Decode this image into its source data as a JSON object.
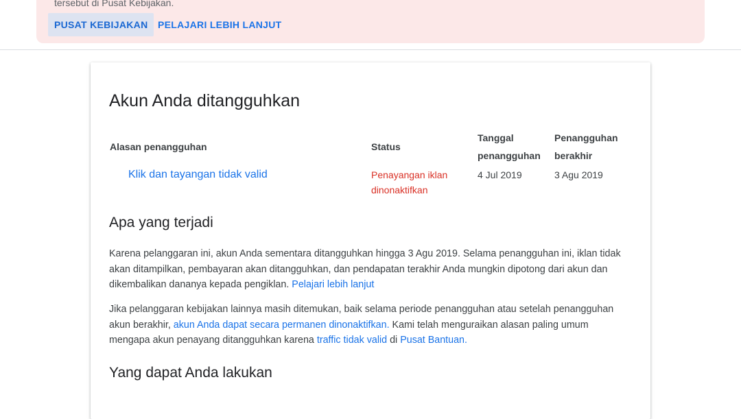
{
  "banner": {
    "cut_text": "tersebut di Pusat Kebijakan.",
    "policy_center_button": "PUSAT KEBIJAKAN",
    "learn_more_button": "PELAJARI LEBIH LANJUT"
  },
  "card": {
    "title": "Akun Anda ditangguhkan",
    "table": {
      "headers": {
        "reason": "Alasan penangguhan",
        "status": "Status",
        "suspend_date_1": "Tanggal",
        "suspend_date_2": "penangguhan",
        "suspend_end_1": "Penangguhan",
        "suspend_end_2": "berakhir"
      },
      "row": {
        "reason": "Klik dan tayangan tidak valid",
        "status_1": "Penayangan iklan",
        "status_2": "dinonaktifkan",
        "suspend_date": "4 Jul 2019",
        "suspend_end": "3 Agu 2019"
      }
    },
    "what_happened": {
      "heading": "Apa yang terjadi",
      "p1_line1": "Karena pelanggaran ini, akun Anda sementara ditangguhkan hingga 3 Agu 2019. Selama penangguhan ini, iklan tidak",
      "p1_line2": "akan ditampilkan, pembayaran akan ditangguhkan, dan pendapatan terakhir Anda mungkin dipotong dari akun dan",
      "p1_line3": "dikembalikan dananya kepada pengiklan. ",
      "p1_link": "Pelajari lebih lanjut",
      "p2_line1": "Jika pelanggaran kebijakan lainnya masih ditemukan, baik selama periode penangguhan atau setelah penangguhan",
      "p2_line2a": "akun berakhir, ",
      "p2_link1": "akun Anda dapat secara permanen dinonaktifkan.",
      "p2_line2b": " Kami telah menguraikan alasan paling umum",
      "p2_line3a": "mengapa akun penayang ditangguhkan karena ",
      "p2_link2": "traffic tidak valid",
      "p2_line3b": " di ",
      "p2_link3": "Pusat Bantuan.",
      "p2_end": ""
    },
    "what_to_do": {
      "heading": "Yang dapat Anda lakukan"
    }
  }
}
